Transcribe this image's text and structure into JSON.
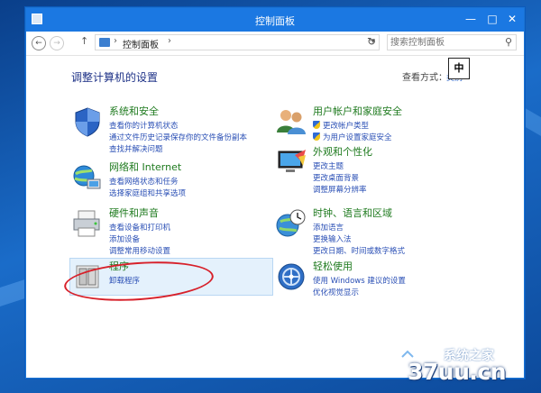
{
  "window": {
    "title": "控制面板"
  },
  "address_bar": {
    "breadcrumb": "控制面板",
    "search_placeholder": "搜索控制面板"
  },
  "page": {
    "heading": "调整计算机的设置",
    "view_by_label": "查看方式",
    "view_by_value": "类别",
    "ime_indicator": "中"
  },
  "categories": {
    "system": {
      "title": "系统和安全",
      "links": [
        "查看你的计算机状态",
        "通过文件历史记录保存你的文件备份副本",
        "查找并解决问题"
      ]
    },
    "network": {
      "title": "网络和 Internet",
      "links": [
        "查看网络状态和任务",
        "选择家庭组和共享选项"
      ]
    },
    "hardware": {
      "title": "硬件和声音",
      "links": [
        "查看设备和打印机",
        "添加设备",
        "调整常用移动设置"
      ]
    },
    "programs": {
      "title": "程序",
      "links": [
        "卸载程序"
      ]
    },
    "user": {
      "title": "用户帐户和家庭安全",
      "links": [
        "更改帐户类型",
        "为用户设置家庭安全"
      ]
    },
    "appearance": {
      "title": "外观和个性化",
      "links": [
        "更改主题",
        "更改桌面背景",
        "调整屏幕分辨率"
      ]
    },
    "clock": {
      "title": "时钟、语言和区域",
      "links": [
        "添加语言",
        "更换输入法",
        "更改日期、时间或数字格式"
      ]
    },
    "ease": {
      "title": "轻松使用",
      "links": [
        "使用 Windows 建议的设置",
        "优化视觉显示"
      ]
    }
  },
  "watermark": {
    "line1": "系统之家",
    "line2": "37uu.cn"
  },
  "colors": {
    "title_bar": "#1b78e2",
    "category_title": "#1e7a1e",
    "link": "#2a4fb5",
    "heading": "#1e3287",
    "annotation_circle": "#d7202a"
  }
}
